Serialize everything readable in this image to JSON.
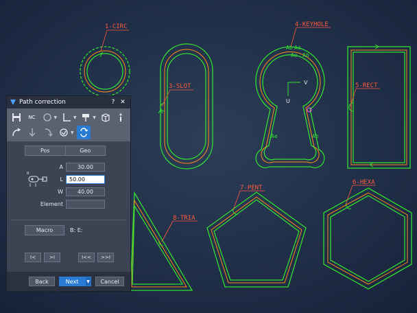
{
  "drawing": {
    "labels": {
      "circ": "1-CIRC",
      "slot": "3-SLOT",
      "keyhole": "4-KEYHOLE",
      "rect": "5-RECT",
      "hexa": "6-HEXA",
      "pent": "7-PENT",
      "tria": "8-TRIA"
    },
    "markers": {
      "keyhole_top1": "Ab",
      "keyhole_top2": "Ae",
      "keyhole_top3": "Ae",
      "keyhole_top4": "Ab",
      "keyhole_bottom_left": "Ae",
      "keyhole_bottom_right": "Ab",
      "axis_v": "V",
      "axis_u": "U"
    },
    "colors": {
      "background": "#1e2d44",
      "path_green": "#33dd33",
      "offset_orange": "#ff8c1a",
      "label_red": "#ff5a3c"
    }
  },
  "panel": {
    "title": "Path correction",
    "help": "?",
    "close": "✕",
    "toolbar": {
      "nc_label": "NC"
    },
    "tabs": {
      "pos": "Pos",
      "geo": "Geo"
    },
    "fields": {
      "a_label": "A",
      "a_value": "30.00",
      "l_label": "L",
      "l_value": "50.00",
      "w_label": "W",
      "w_value": "40.00",
      "element_label": "Element",
      "element_value": ""
    },
    "macro": {
      "button": "Macro",
      "be_text": "B: E:"
    },
    "nav": {
      "first_small": "I<",
      "next_small": ">I",
      "first": "I<<",
      "last": ">>I"
    },
    "footer": {
      "back": "Back",
      "next": "Next",
      "cancel": "Cancel"
    }
  }
}
